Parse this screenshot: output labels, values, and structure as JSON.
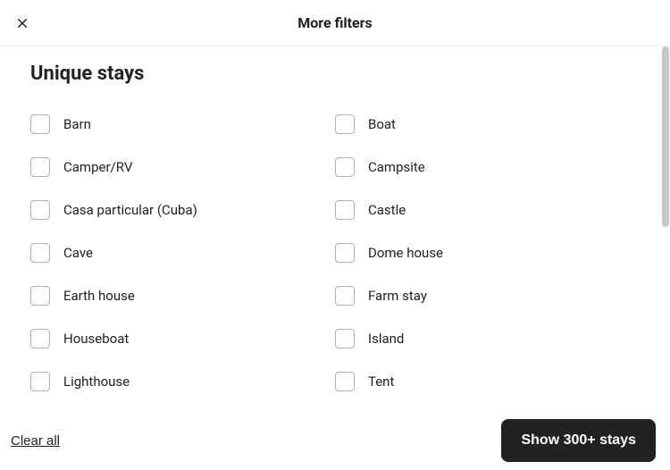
{
  "header": {
    "title": "More filters"
  },
  "section": {
    "title": "Unique stays"
  },
  "options": [
    {
      "label": "Barn",
      "checked": false
    },
    {
      "label": "Boat",
      "checked": false
    },
    {
      "label": "Camper/RV",
      "checked": false
    },
    {
      "label": "Campsite",
      "checked": false
    },
    {
      "label": "Casa particular (Cuba)",
      "checked": false
    },
    {
      "label": "Castle",
      "checked": false
    },
    {
      "label": "Cave",
      "checked": false
    },
    {
      "label": "Dome house",
      "checked": false
    },
    {
      "label": "Earth house",
      "checked": false
    },
    {
      "label": "Farm stay",
      "checked": false
    },
    {
      "label": "Houseboat",
      "checked": false
    },
    {
      "label": "Island",
      "checked": false
    },
    {
      "label": "Lighthouse",
      "checked": false
    },
    {
      "label": "Tent",
      "checked": false
    }
  ],
  "footer": {
    "clear_label": "Clear all",
    "show_label": "Show 300+ stays"
  }
}
